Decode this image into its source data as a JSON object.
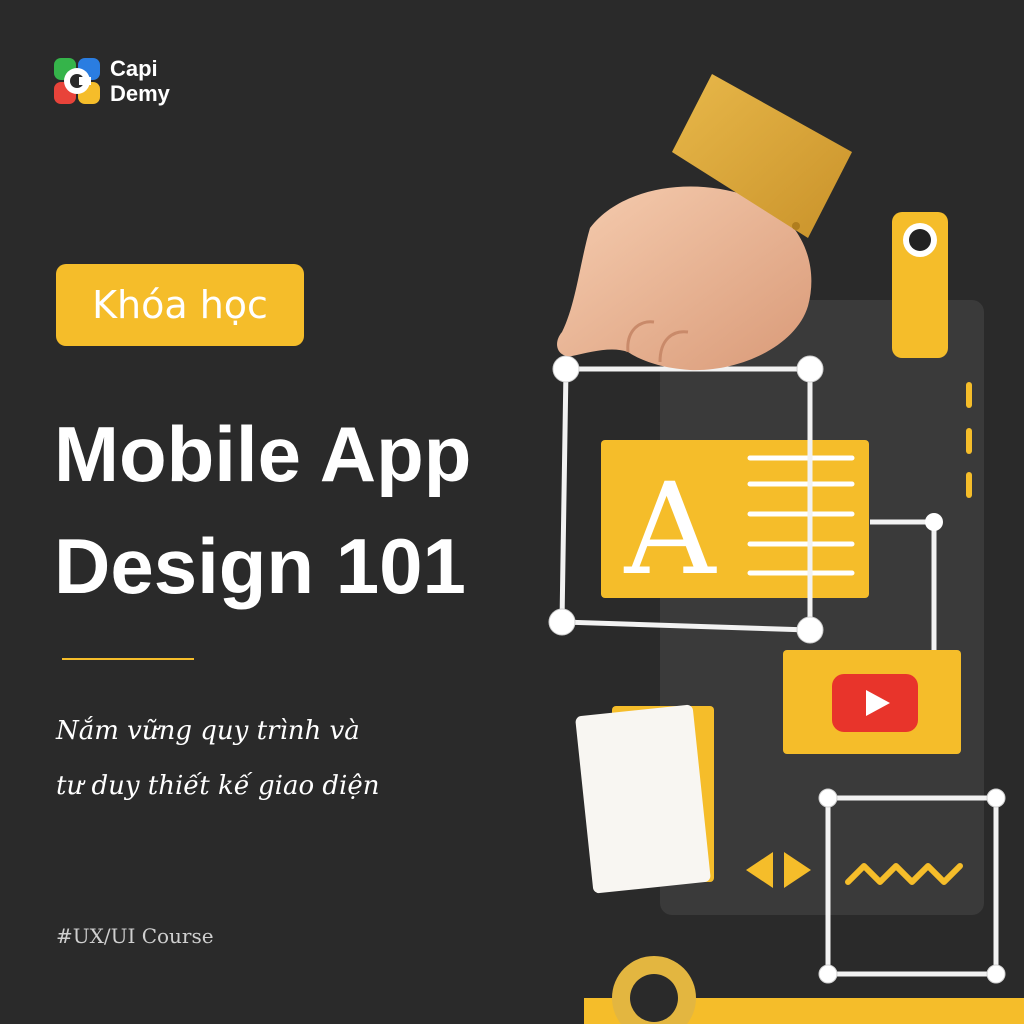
{
  "brand": {
    "line1": "Capi",
    "line2": "Demy",
    "colors": {
      "green": "#35b44a",
      "blue": "#2a7de1",
      "red": "#e8433a",
      "yellow": "#f5bd2a"
    }
  },
  "badge": {
    "label": "Khóa học"
  },
  "title": {
    "line1": "Mobile App",
    "line2": "Design 101"
  },
  "subtitle": {
    "line1": "Nắm vững quy trình và",
    "line2": "tư duy thiết kế giao diện"
  },
  "hashtag": "#UX/UI Course",
  "theme": {
    "background": "#2a2a2a",
    "accent": "#f5bd2a",
    "text": "#ffffff"
  },
  "illustration": {
    "icons": [
      "hand-pointer-icon",
      "typography-a-icon",
      "video-play-icon",
      "prev-next-arrows-icon",
      "zigzag-wave-icon",
      "blank-card-icon"
    ],
    "glyph": "A"
  }
}
